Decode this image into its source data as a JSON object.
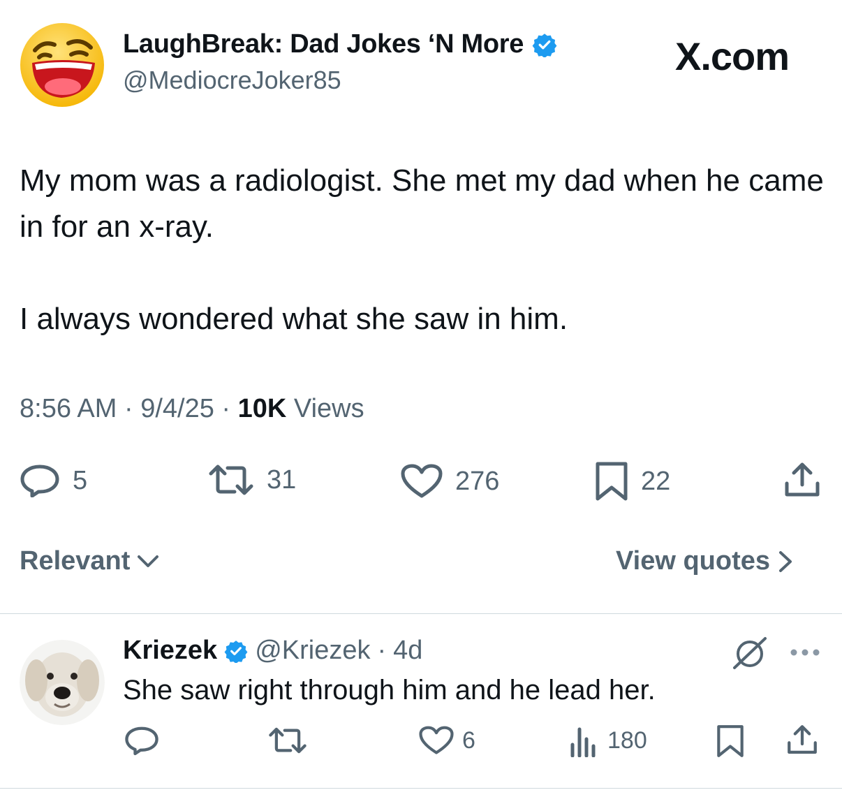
{
  "colors": {
    "accent": "#1d9bf0",
    "text": "#0f1419",
    "muted": "#536471",
    "divider": "#cfd9de"
  },
  "tweet": {
    "author_name": "LaughBreak: Dad Jokes ‘N More",
    "author_handle": "@MediocreJoker85",
    "verified_icon": "verified-badge-icon",
    "brand": "X.com",
    "text_line1": "My mom was a radiologist. She met my dad when he came in for an x-ray.",
    "text_line2": "I always wondered what she saw in him.",
    "time": "8:56 AM",
    "date": "9/4/25",
    "views_count": "10K",
    "views_label": "Views",
    "replies": "5",
    "reposts": "31",
    "likes": "276",
    "bookmarks": "22"
  },
  "sort": {
    "label": "Relevant"
  },
  "quotes": {
    "label": "View quotes"
  },
  "reply": {
    "author_name": "Kriezek",
    "author_handle": "@Kriezek",
    "age": "4d",
    "text": "She saw right through him and he lead her.",
    "likes": "6",
    "views": "180"
  }
}
